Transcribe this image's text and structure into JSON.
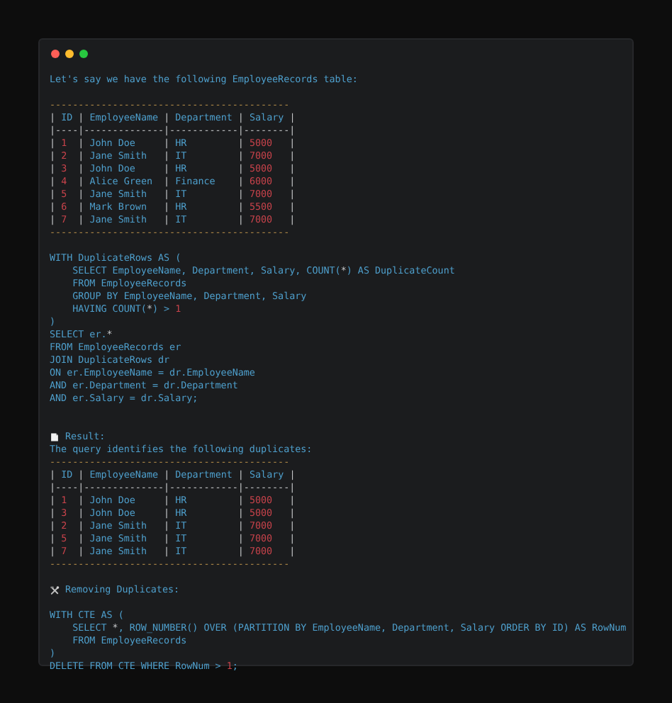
{
  "window": {
    "controls": [
      {
        "color": "#ff5f57"
      },
      {
        "color": "#febc2e"
      },
      {
        "color": "#28c840"
      }
    ]
  },
  "lines": [
    {
      "kind": "text",
      "parts": [
        {
          "text": "Let's say we have the following EmployeeRecords table:",
          "kind": "plain"
        }
      ]
    },
    {
      "kind": "blank"
    },
    {
      "kind": "text",
      "parts": [
        {
          "text": "------------------------------------------",
          "kind": "rule"
        }
      ]
    },
    {
      "kind": "text",
      "parts": [
        {
          "text": "| ",
          "kind": "pipe"
        },
        {
          "text": "ID",
          "kind": "plain"
        },
        {
          "text": " | ",
          "kind": "pipe"
        },
        {
          "text": "EmployeeName",
          "kind": "plain"
        },
        {
          "text": " | ",
          "kind": "pipe"
        },
        {
          "text": "Department",
          "kind": "plain"
        },
        {
          "text": " | ",
          "kind": "pipe"
        },
        {
          "text": "Salary",
          "kind": "plain"
        },
        {
          "text": " |",
          "kind": "pipe"
        }
      ]
    },
    {
      "kind": "text",
      "parts": [
        {
          "text": "|----|--------------|------------|--------|",
          "kind": "pipe"
        }
      ]
    },
    {
      "kind": "text",
      "parts": [
        {
          "text": "| ",
          "kind": "pipe"
        },
        {
          "text": "1",
          "kind": "number"
        },
        {
          "text": "  | ",
          "kind": "pipe"
        },
        {
          "text": "John Doe     ",
          "kind": "plain"
        },
        {
          "text": "| ",
          "kind": "pipe"
        },
        {
          "text": "HR         ",
          "kind": "plain"
        },
        {
          "text": "| ",
          "kind": "pipe"
        },
        {
          "text": "5000",
          "kind": "number"
        },
        {
          "text": "   |",
          "kind": "pipe"
        }
      ]
    },
    {
      "kind": "text",
      "parts": [
        {
          "text": "| ",
          "kind": "pipe"
        },
        {
          "text": "2",
          "kind": "number"
        },
        {
          "text": "  | ",
          "kind": "pipe"
        },
        {
          "text": "Jane Smith   ",
          "kind": "plain"
        },
        {
          "text": "| ",
          "kind": "pipe"
        },
        {
          "text": "IT         ",
          "kind": "plain"
        },
        {
          "text": "| ",
          "kind": "pipe"
        },
        {
          "text": "7000",
          "kind": "number"
        },
        {
          "text": "   |",
          "kind": "pipe"
        }
      ]
    },
    {
      "kind": "text",
      "parts": [
        {
          "text": "| ",
          "kind": "pipe"
        },
        {
          "text": "3",
          "kind": "number"
        },
        {
          "text": "  | ",
          "kind": "pipe"
        },
        {
          "text": "John Doe     ",
          "kind": "plain"
        },
        {
          "text": "| ",
          "kind": "pipe"
        },
        {
          "text": "HR         ",
          "kind": "plain"
        },
        {
          "text": "| ",
          "kind": "pipe"
        },
        {
          "text": "5000",
          "kind": "number"
        },
        {
          "text": "   |",
          "kind": "pipe"
        }
      ]
    },
    {
      "kind": "text",
      "parts": [
        {
          "text": "| ",
          "kind": "pipe"
        },
        {
          "text": "4",
          "kind": "number"
        },
        {
          "text": "  | ",
          "kind": "pipe"
        },
        {
          "text": "Alice Green  ",
          "kind": "plain"
        },
        {
          "text": "| ",
          "kind": "pipe"
        },
        {
          "text": "Finance    ",
          "kind": "plain"
        },
        {
          "text": "| ",
          "kind": "pipe"
        },
        {
          "text": "6000",
          "kind": "number"
        },
        {
          "text": "   |",
          "kind": "pipe"
        }
      ]
    },
    {
      "kind": "text",
      "parts": [
        {
          "text": "| ",
          "kind": "pipe"
        },
        {
          "text": "5",
          "kind": "number"
        },
        {
          "text": "  | ",
          "kind": "pipe"
        },
        {
          "text": "Jane Smith   ",
          "kind": "plain"
        },
        {
          "text": "| ",
          "kind": "pipe"
        },
        {
          "text": "IT         ",
          "kind": "plain"
        },
        {
          "text": "| ",
          "kind": "pipe"
        },
        {
          "text": "7000",
          "kind": "number"
        },
        {
          "text": "   |",
          "kind": "pipe"
        }
      ]
    },
    {
      "kind": "text",
      "parts": [
        {
          "text": "| ",
          "kind": "pipe"
        },
        {
          "text": "6",
          "kind": "number"
        },
        {
          "text": "  | ",
          "kind": "pipe"
        },
        {
          "text": "Mark Brown   ",
          "kind": "plain"
        },
        {
          "text": "| ",
          "kind": "pipe"
        },
        {
          "text": "HR         ",
          "kind": "plain"
        },
        {
          "text": "| ",
          "kind": "pipe"
        },
        {
          "text": "5500",
          "kind": "number"
        },
        {
          "text": "   |",
          "kind": "pipe"
        }
      ]
    },
    {
      "kind": "text",
      "parts": [
        {
          "text": "| ",
          "kind": "pipe"
        },
        {
          "text": "7",
          "kind": "number"
        },
        {
          "text": "  | ",
          "kind": "pipe"
        },
        {
          "text": "Jane Smith   ",
          "kind": "plain"
        },
        {
          "text": "| ",
          "kind": "pipe"
        },
        {
          "text": "IT         ",
          "kind": "plain"
        },
        {
          "text": "| ",
          "kind": "pipe"
        },
        {
          "text": "7000",
          "kind": "number"
        },
        {
          "text": "   |",
          "kind": "pipe"
        }
      ]
    },
    {
      "kind": "text",
      "parts": [
        {
          "text": "------------------------------------------",
          "kind": "rule"
        }
      ]
    },
    {
      "kind": "blank"
    },
    {
      "kind": "text",
      "parts": [
        {
          "text": "WITH DuplicateRows AS (",
          "kind": "plain"
        }
      ]
    },
    {
      "kind": "text",
      "parts": [
        {
          "text": "    SELECT EmployeeName, Department, Salary, COUNT(",
          "kind": "plain"
        },
        {
          "text": "*",
          "kind": "pipe"
        },
        {
          "text": ") AS DuplicateCount",
          "kind": "plain"
        }
      ]
    },
    {
      "kind": "text",
      "parts": [
        {
          "text": "    FROM EmployeeRecords",
          "kind": "plain"
        }
      ]
    },
    {
      "kind": "text",
      "parts": [
        {
          "text": "    GROUP BY EmployeeName, Department, Salary",
          "kind": "plain"
        }
      ]
    },
    {
      "kind": "text",
      "parts": [
        {
          "text": "    HAVING COUNT(",
          "kind": "plain"
        },
        {
          "text": "*",
          "kind": "pipe"
        },
        {
          "text": ") > ",
          "kind": "plain"
        },
        {
          "text": "1",
          "kind": "number"
        }
      ]
    },
    {
      "kind": "text",
      "parts": [
        {
          "text": ")",
          "kind": "plain"
        }
      ]
    },
    {
      "kind": "text",
      "parts": [
        {
          "text": "SELECT er.",
          "kind": "plain"
        },
        {
          "text": "*",
          "kind": "pipe"
        }
      ]
    },
    {
      "kind": "text",
      "parts": [
        {
          "text": "FROM EmployeeRecords er",
          "kind": "plain"
        }
      ]
    },
    {
      "kind": "text",
      "parts": [
        {
          "text": "JOIN DuplicateRows dr",
          "kind": "plain"
        }
      ]
    },
    {
      "kind": "text",
      "parts": [
        {
          "text": "ON er.EmployeeName = dr.EmployeeName",
          "kind": "plain"
        }
      ]
    },
    {
      "kind": "text",
      "parts": [
        {
          "text": "AND er.Department = dr.Department",
          "kind": "plain"
        }
      ]
    },
    {
      "kind": "text",
      "parts": [
        {
          "text": "AND er.Salary = dr.Salary;",
          "kind": "plain"
        }
      ]
    },
    {
      "kind": "blank"
    },
    {
      "kind": "blank"
    },
    {
      "kind": "note",
      "parts": [
        {
          "text": "Result:",
          "kind": "plain"
        }
      ]
    },
    {
      "kind": "text",
      "parts": [
        {
          "text": "The query identifies the following duplicates:",
          "kind": "plain"
        }
      ]
    },
    {
      "kind": "text",
      "parts": [
        {
          "text": "------------------------------------------",
          "kind": "rule"
        }
      ]
    },
    {
      "kind": "text",
      "parts": [
        {
          "text": "| ",
          "kind": "pipe"
        },
        {
          "text": "ID",
          "kind": "plain"
        },
        {
          "text": " | ",
          "kind": "pipe"
        },
        {
          "text": "EmployeeName",
          "kind": "plain"
        },
        {
          "text": " | ",
          "kind": "pipe"
        },
        {
          "text": "Department",
          "kind": "plain"
        },
        {
          "text": " | ",
          "kind": "pipe"
        },
        {
          "text": "Salary",
          "kind": "plain"
        },
        {
          "text": " |",
          "kind": "pipe"
        }
      ]
    },
    {
      "kind": "text",
      "parts": [
        {
          "text": "|----|--------------|------------|--------|",
          "kind": "pipe"
        }
      ]
    },
    {
      "kind": "text",
      "parts": [
        {
          "text": "| ",
          "kind": "pipe"
        },
        {
          "text": "1",
          "kind": "number"
        },
        {
          "text": "  | ",
          "kind": "pipe"
        },
        {
          "text": "John Doe     ",
          "kind": "plain"
        },
        {
          "text": "| ",
          "kind": "pipe"
        },
        {
          "text": "HR         ",
          "kind": "plain"
        },
        {
          "text": "| ",
          "kind": "pipe"
        },
        {
          "text": "5000",
          "kind": "number"
        },
        {
          "text": "   |",
          "kind": "pipe"
        }
      ]
    },
    {
      "kind": "text",
      "parts": [
        {
          "text": "| ",
          "kind": "pipe"
        },
        {
          "text": "3",
          "kind": "number"
        },
        {
          "text": "  | ",
          "kind": "pipe"
        },
        {
          "text": "John Doe     ",
          "kind": "plain"
        },
        {
          "text": "| ",
          "kind": "pipe"
        },
        {
          "text": "HR         ",
          "kind": "plain"
        },
        {
          "text": "| ",
          "kind": "pipe"
        },
        {
          "text": "5000",
          "kind": "number"
        },
        {
          "text": "   |",
          "kind": "pipe"
        }
      ]
    },
    {
      "kind": "text",
      "parts": [
        {
          "text": "| ",
          "kind": "pipe"
        },
        {
          "text": "2",
          "kind": "number"
        },
        {
          "text": "  | ",
          "kind": "pipe"
        },
        {
          "text": "Jane Smith   ",
          "kind": "plain"
        },
        {
          "text": "| ",
          "kind": "pipe"
        },
        {
          "text": "IT         ",
          "kind": "plain"
        },
        {
          "text": "| ",
          "kind": "pipe"
        },
        {
          "text": "7000",
          "kind": "number"
        },
        {
          "text": "   |",
          "kind": "pipe"
        }
      ]
    },
    {
      "kind": "text",
      "parts": [
        {
          "text": "| ",
          "kind": "pipe"
        },
        {
          "text": "5",
          "kind": "number"
        },
        {
          "text": "  | ",
          "kind": "pipe"
        },
        {
          "text": "Jane Smith   ",
          "kind": "plain"
        },
        {
          "text": "| ",
          "kind": "pipe"
        },
        {
          "text": "IT         ",
          "kind": "plain"
        },
        {
          "text": "| ",
          "kind": "pipe"
        },
        {
          "text": "7000",
          "kind": "number"
        },
        {
          "text": "   |",
          "kind": "pipe"
        }
      ]
    },
    {
      "kind": "text",
      "parts": [
        {
          "text": "| ",
          "kind": "pipe"
        },
        {
          "text": "7",
          "kind": "number"
        },
        {
          "text": "  | ",
          "kind": "pipe"
        },
        {
          "text": "Jane Smith   ",
          "kind": "plain"
        },
        {
          "text": "| ",
          "kind": "pipe"
        },
        {
          "text": "IT         ",
          "kind": "plain"
        },
        {
          "text": "| ",
          "kind": "pipe"
        },
        {
          "text": "7000",
          "kind": "number"
        },
        {
          "text": "   |",
          "kind": "pipe"
        }
      ]
    },
    {
      "kind": "text",
      "parts": [
        {
          "text": "------------------------------------------",
          "kind": "rule"
        }
      ]
    },
    {
      "kind": "blank"
    },
    {
      "kind": "tools",
      "parts": [
        {
          "text": "Removing Duplicates:",
          "kind": "plain"
        }
      ]
    },
    {
      "kind": "blank"
    },
    {
      "kind": "text",
      "parts": [
        {
          "text": "WITH CTE AS (",
          "kind": "plain"
        }
      ]
    },
    {
      "kind": "text",
      "parts": [
        {
          "text": "    SELECT ",
          "kind": "plain"
        },
        {
          "text": "*",
          "kind": "pipe"
        },
        {
          "text": ", ROW_NUMBER() OVER (PARTITION BY EmployeeName, Department, Salary ORDER BY ID) AS RowNum",
          "kind": "plain"
        }
      ]
    },
    {
      "kind": "text",
      "parts": [
        {
          "text": "    FROM EmployeeRecords",
          "kind": "plain"
        }
      ]
    },
    {
      "kind": "text",
      "parts": [
        {
          "text": ")",
          "kind": "plain"
        }
      ]
    },
    {
      "kind": "text",
      "parts": [
        {
          "text": "DELETE FROM CTE WHERE RowNum > ",
          "kind": "plain"
        },
        {
          "text": "1",
          "kind": "number"
        },
        {
          "text": ";",
          "kind": "plain"
        }
      ]
    }
  ]
}
